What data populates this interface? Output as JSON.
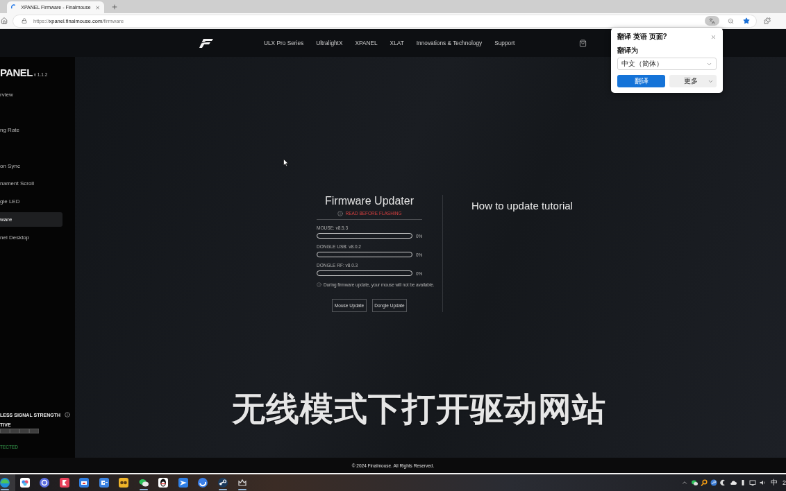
{
  "browser": {
    "tab": {
      "title": "XPANEL Firmware - Finalmouse"
    },
    "url": {
      "scheme": "https://",
      "host": "xpanel.finalmouse.com",
      "path": "/firmware"
    },
    "translate_button": {
      "pressed": true
    },
    "favorite": {
      "on": true
    }
  },
  "translate_popup": {
    "title": "翻译 英语 页面?",
    "label": "翻译为",
    "language": "中文（简体）",
    "translate": "翻译",
    "more": "更多"
  },
  "nav": {
    "links": [
      "ULX Pro Series",
      "UltralightX",
      "XPANEL",
      "XLAT",
      "Innovations & Technology",
      "Support"
    ]
  },
  "sidebar": {
    "title": "PANEL",
    "version": "v 1.1.2",
    "items": [
      {
        "label": "rview",
        "selected": false
      },
      {
        "label": "ng Rate",
        "selected": false
      },
      {
        "label": "on Sync",
        "selected": false
      },
      {
        "label": "nament Scroll",
        "selected": false
      },
      {
        "label": "gle LED",
        "selected": false
      },
      {
        "label": "ware",
        "selected": true
      },
      {
        "label": "nel Desktop",
        "selected": false
      }
    ],
    "signal": {
      "title": "LESS SIGNAL STRENGTH",
      "status": "TIVE",
      "connection": "TECTED"
    }
  },
  "firmware": {
    "title": "Firmware Updater",
    "warning": "READ BEFORE FLASHING",
    "devices": [
      {
        "label": "MOUSE: v8.5.3",
        "level": 0,
        "reading": "0%"
      },
      {
        "label": "DONGLE USB: v8.0.2",
        "level": 0,
        "reading": "0%"
      },
      {
        "label": "DONGLE RF: v8.0.3",
        "level": 0,
        "reading": "0%"
      }
    ],
    "note": "During firmware update, your mouse will not be available.",
    "buttons": [
      "Mouse Update",
      "Dongle Update"
    ]
  },
  "tutorial": {
    "title": "How to update tutorial"
  },
  "caption": "无线模式下打开驱动网站",
  "footer": "© 2024 Finalmouse. All Rights Reserved.",
  "taskbar": {
    "apps": [
      {
        "running": true,
        "active": true
      },
      {
        "running": false,
        "active": false
      },
      {
        "running": false,
        "active": false
      },
      {
        "running": false,
        "active": false
      },
      {
        "running": false,
        "active": false
      },
      {
        "running": false,
        "active": false
      },
      {
        "running": false,
        "active": false
      },
      {
        "running": true,
        "active": false
      },
      {
        "running": false,
        "active": false
      },
      {
        "running": false,
        "active": false
      },
      {
        "running": false,
        "active": false
      },
      {
        "running": true,
        "active": false
      },
      {
        "running": true,
        "active": false
      }
    ],
    "ime": "中",
    "clock": "2"
  }
}
